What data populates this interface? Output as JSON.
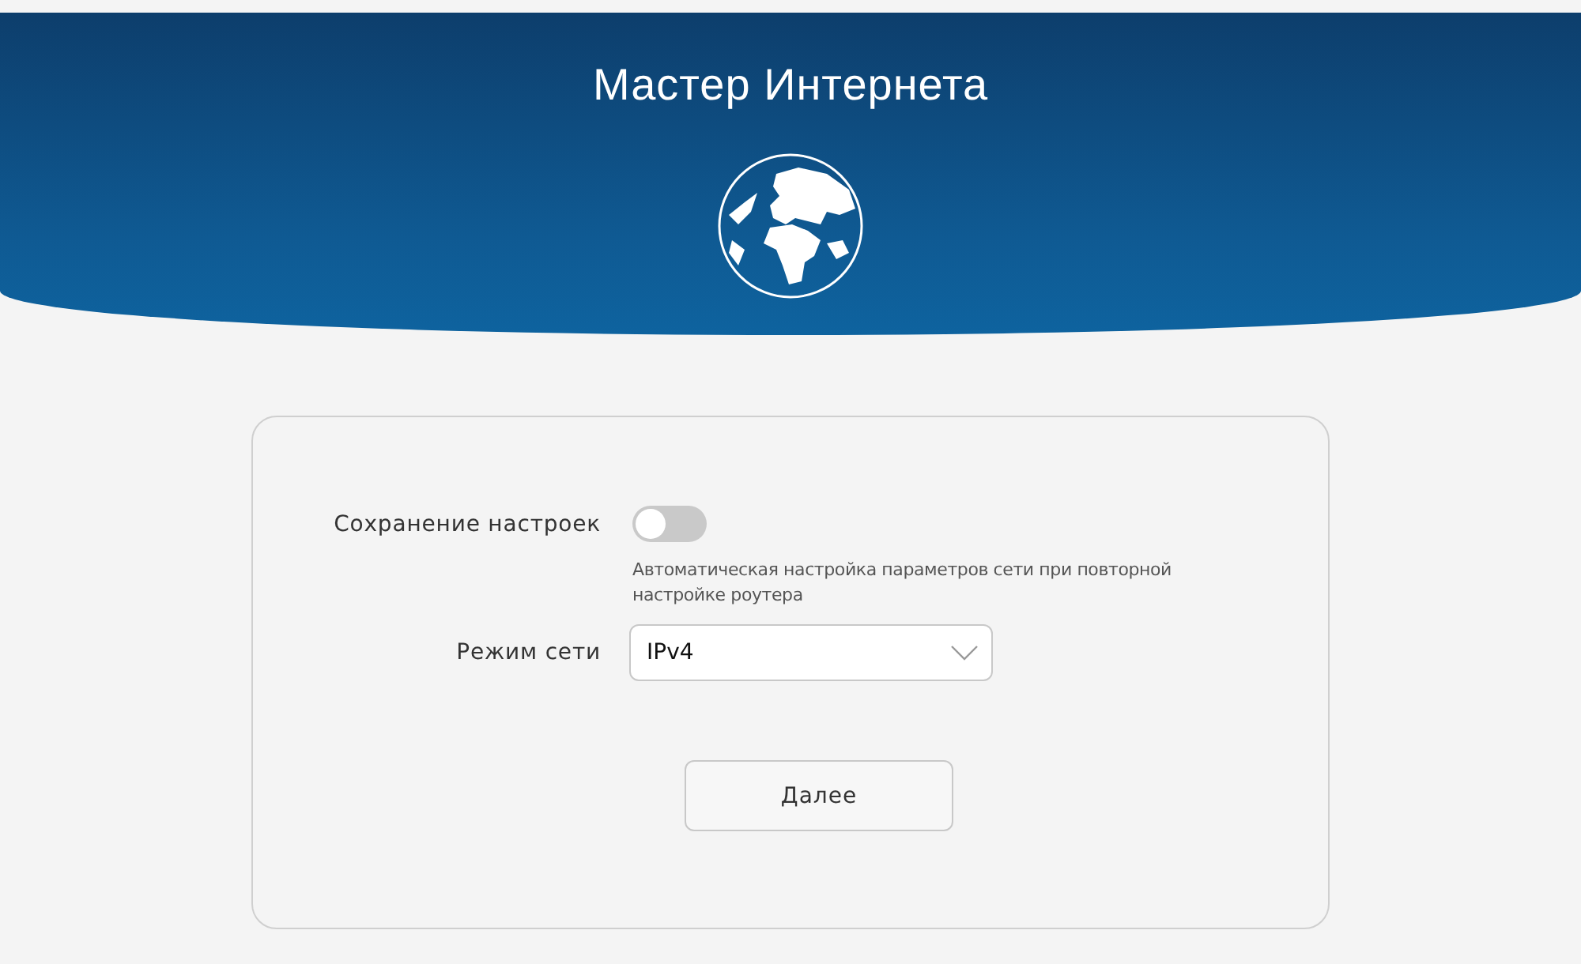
{
  "header": {
    "title": "Мастер Интернета"
  },
  "form": {
    "save_settings": {
      "label": "Сохранение настроек",
      "on": false,
      "description": "Автоматическая настройка параметров сети при повторной настройке роутера"
    },
    "network_mode": {
      "label": "Режим сети",
      "value": "IPv4"
    },
    "next_button": "Далее"
  }
}
